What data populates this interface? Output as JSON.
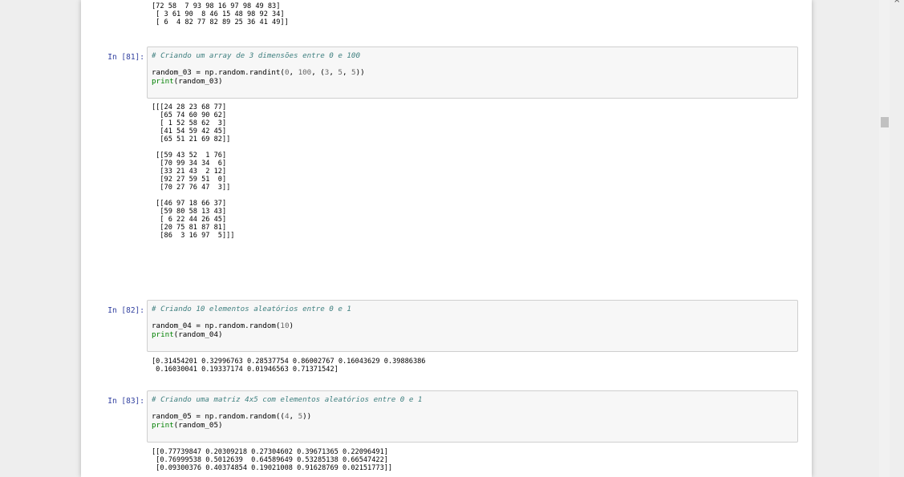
{
  "outputs": {
    "top_tail": "[72 58  7 93 98 16 97 98 49 83]\n [ 3 61 90  8 46 15 48 98 92 34]\n [ 6  4 82 77 82 89 25 36 41 49]]",
    "out_81": "[[[24 28 23 68 77]\n  [65 74 60 90 62]\n  [ 1 52 58 62  3]\n  [41 54 59 42 45]\n  [65 51 21 69 82]]\n\n [[59 43 52  1 76]\n  [70 99 34 34  6]\n  [33 21 43  2 12]\n  [92 27 59 51  0]\n  [70 27 76 47  3]]\n\n [[46 97 18 66 37]\n  [59 80 58 13 43]\n  [ 6 22 44 26 45]\n  [20 75 81 87 81]\n  [86  3 16 97  5]]]",
    "out_82": "[0.31454201 0.32996763 0.28537754 0.86002767 0.16043629 0.39886386\n 0.16030041 0.19337174 0.01946563 0.71371542]",
    "out_83": "[[0.77739847 0.20309218 0.27304602 0.39671365 0.22096491]\n [0.76999538 0.5012639  0.64589649 0.53285138 0.66547422]\n [0.09300376 0.40374854 0.19021008 0.91628769 0.02151773]]"
  },
  "cells": {
    "c81": {
      "prompt": "In [81]:",
      "comment": "# Criando um array de 3 dimensões entre 0 e 100",
      "line2_lead": "random_03 = np.random.randint(",
      "line2_num1": "0",
      "line2_sep1": ", ",
      "line2_num2": "100",
      "line2_sep2": ", (",
      "line2_num3": "3",
      "line2_sep3": ", ",
      "line2_num4": "5",
      "line2_sep4": ", ",
      "line2_num5": "5",
      "line2_tail": "))",
      "print_kw": "print",
      "print_arg": "(random_03)"
    },
    "c82": {
      "prompt": "In [82]:",
      "comment": "# Criando 10 elementos aleatórios entre 0 e 1",
      "line2_lead": "random_04 = np.random.random(",
      "line2_num1": "10",
      "line2_tail": ")",
      "print_kw": "print",
      "print_arg": "(random_04)"
    },
    "c83": {
      "prompt": "In [83]:",
      "comment": "# Criando uma matriz 4x5 com elementos aleatórios entre 0 e 1",
      "line2_lead": "random_05 = np.random.random((",
      "line2_num1": "4",
      "line2_sep1": ", ",
      "line2_num2": "5",
      "line2_tail": "))",
      "print_kw": "print",
      "print_arg": "(random_05)"
    }
  },
  "window": {
    "close_glyph": "×"
  },
  "colors": {
    "prompt": "#303f9f",
    "comment": "#408080",
    "builtin": "#008000",
    "number": "#666666"
  },
  "icons": {
    "close": "close-icon"
  }
}
